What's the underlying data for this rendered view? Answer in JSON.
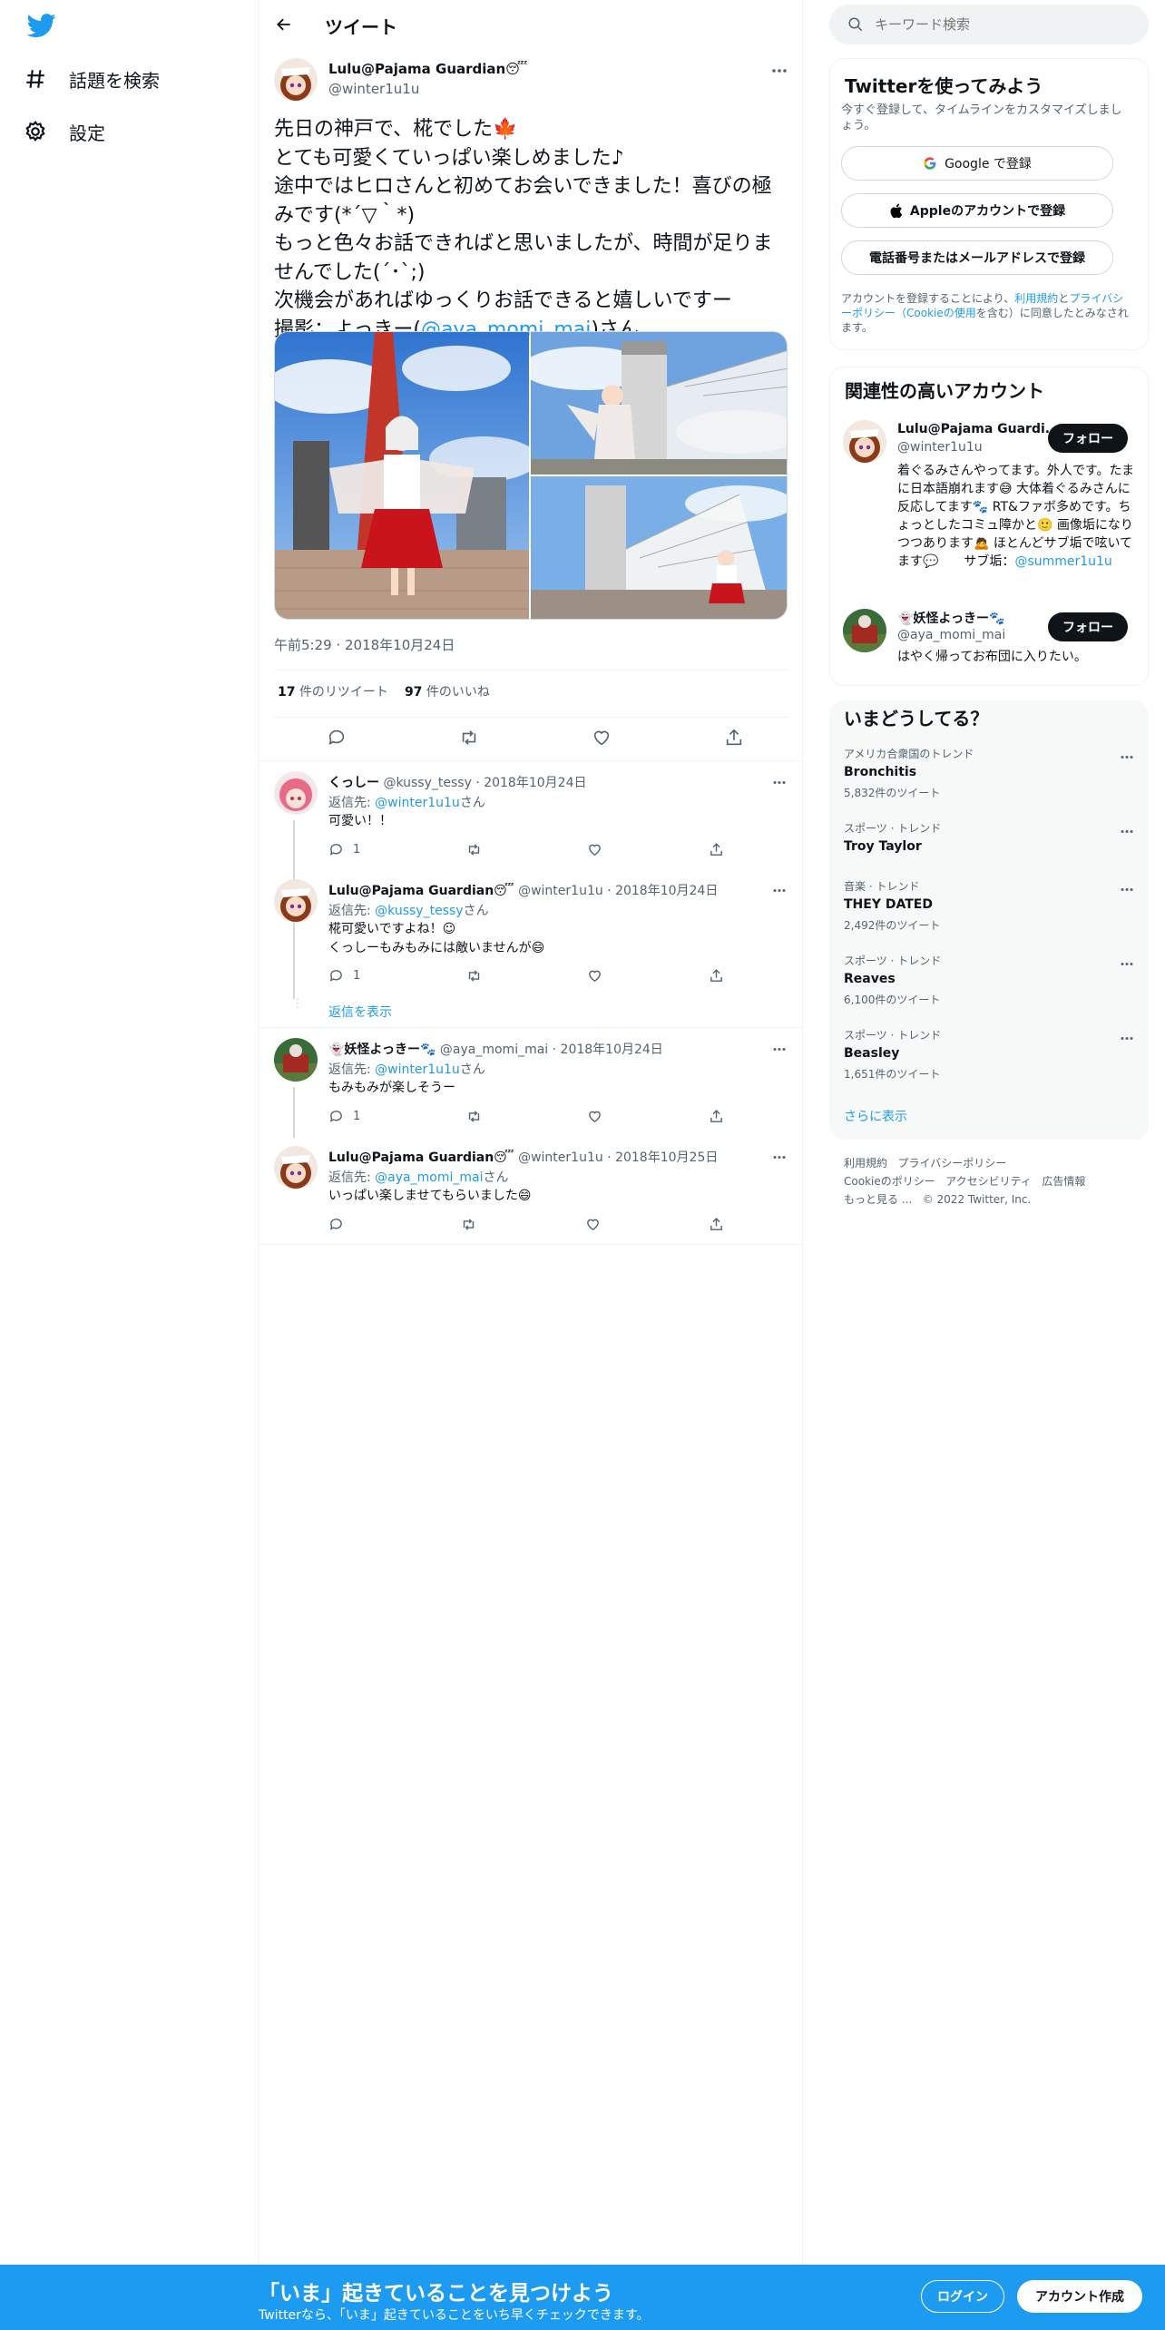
{
  "nav": {
    "explore_label": "話題を検索",
    "settings_label": "設定"
  },
  "header": {
    "title": "ツイート"
  },
  "main_tweet": {
    "name": "Lulu@Pajama Guardian😴",
    "handle": "@winter1u1u",
    "text_line1": "先日の神戸で、椛でした🍁",
    "text_line2": "とても可愛くていっぱい楽しめました♪",
    "text_line3": "途中ではヒロさんと初めてお会いできました！喜びの極みです(*´▽｀*)",
    "text_line4": "もっと色々お話できればと思いましたが、時間が足りませんでした(´･`;)",
    "text_line5": "次機会があればゆっくりお話できると嬉しいですー",
    "text_line6_prefix": "撮影：よっきー(",
    "text_line6_mention": "@aya_momi_mai",
    "text_line6_suffix": ")さん",
    "timestamp": "午前5:29 · 2018年10月24日",
    "retweets_count": "17",
    "retweets_label": "件のリツイート",
    "likes_count": "97",
    "likes_label": "件のいいね"
  },
  "replies": [
    {
      "name": "くっしー",
      "handle": "@kussy_tessy",
      "date": "· 2018年10月24日",
      "reply_to_prefix": "返信先: ",
      "reply_to": "@winter1u1u",
      "reply_to_suffix": "さん",
      "body": "可愛い！！",
      "reply_count": "1"
    },
    {
      "name": "Lulu@Pajama Guardian😴",
      "handle": "@winter1u1u",
      "date": "· 2018年10月24日",
      "reply_to_prefix": "返信先: ",
      "reply_to": "@kussy_tessy",
      "reply_to_suffix": "さん",
      "body": "椛可愛いですよね！☺\nくっしーもみもみには敵いませんが😄",
      "reply_count": "1"
    },
    {
      "name": "👻妖怪よっきー🐾",
      "handle": "@aya_momi_mai",
      "date": "· 2018年10月24日",
      "reply_to_prefix": "返信先: ",
      "reply_to": "@winter1u1u",
      "reply_to_suffix": "さん",
      "body": "もみもみが楽しそうー",
      "reply_count": "1"
    },
    {
      "name": "Lulu@Pajama Guardian😴",
      "handle": "@winter1u1u",
      "date": "· 2018年10月25日",
      "reply_to_prefix": "返信先: ",
      "reply_to": "@aya_momi_mai",
      "reply_to_suffix": "さん",
      "body": "いっぱい楽しませてもらいました😄",
      "reply_count": ""
    }
  ],
  "show_replies_label": "返信を表示",
  "search": {
    "placeholder": "キーワード検索"
  },
  "signup_panel": {
    "title": "Twitterを使ってみよう",
    "subtitle": "今すぐ登録して、タイムラインをカスタマイズしましょう。",
    "google_label": "Google で登録",
    "apple_label": "Appleのアカウントで登録",
    "phone_label": "電話番号またはメールアドレスで登録",
    "terms_prefix": "アカウントを登録することにより、",
    "terms_link": "利用規約",
    "terms_and": "と",
    "privacy_link": "プライバシーポリシー（Cookieの使用",
    "terms_suffix": "を含む）に同意したとみなされます。"
  },
  "related_panel": {
    "title": "関連性の高いアカウント",
    "accounts": [
      {
        "name": "Lulu@Pajama Guardi...",
        "handle": "@winter1u1u",
        "bio": "着ぐるみさんやってます。外人です。たまに日本語崩れます😅 大体着ぐるみさんに反応してます🐾 RT&ファボ多めです。ちょっとしたコミュ障かと🙂 画像垢になりつつあります🙇 ほとんどサブ垢で呟いてます💬　　サブ垢：",
        "bio_link": "@summer1u1u",
        "follow_label": "フォロー"
      },
      {
        "name": "👻妖怪よっきー🐾",
        "handle": "@aya_momi_mai",
        "bio": "はやく帰ってお布団に入りたい。",
        "bio_link": "",
        "follow_label": "フォロー"
      }
    ]
  },
  "trends_panel": {
    "title": "いまどうしてる？",
    "trends": [
      {
        "category": "アメリカ合衆国のトレンド",
        "name": "Bronchitis",
        "count": "5,832件のツイート"
      },
      {
        "category": "スポーツ · トレンド",
        "name": "Troy Taylor",
        "count": ""
      },
      {
        "category": "音楽 · トレンド",
        "name": "THEY DATED",
        "count": "2,492件のツイート"
      },
      {
        "category": "スポーツ · トレンド",
        "name": "Reaves",
        "count": "6,100件のツイート"
      },
      {
        "category": "スポーツ · トレンド",
        "name": "Beasley",
        "count": "1,651件のツイート"
      }
    ],
    "show_more": "さらに表示"
  },
  "footer": {
    "terms": "利用規約",
    "privacy": "プライバシーポリシー",
    "cookie": "Cookieのポリシー",
    "accessibility": "アクセシビリティ",
    "ads": "広告情報",
    "more": "もっと見る ...",
    "copyright": "© 2022 Twitter, Inc."
  },
  "bottom_bar": {
    "title": "「いま」起きていることを見つけよう",
    "subtitle": "Twitterなら、「いま」起きていることをいち早くチェックできます。",
    "login": "ログイン",
    "signup": "アカウント作成"
  },
  "colors": {
    "accent": "#1d9bf0",
    "text": "#0f1419",
    "muted": "#536471",
    "bottom_bar": "#1d9bf0"
  }
}
